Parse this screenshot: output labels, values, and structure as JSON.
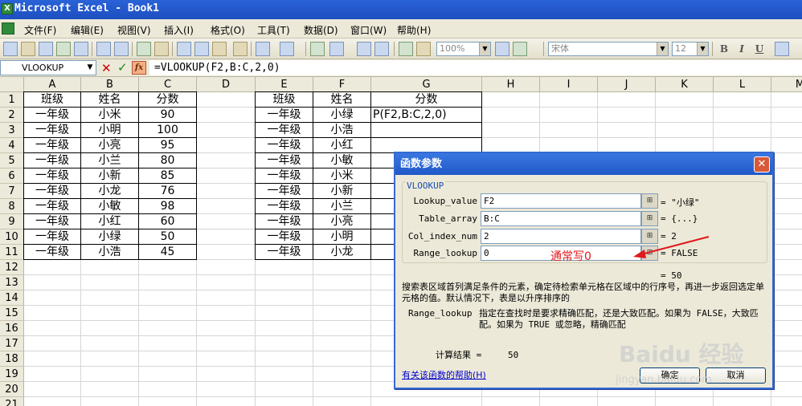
{
  "window": {
    "title": "Microsoft Excel - Book1"
  },
  "menu": [
    "文件(F)",
    "编辑(E)",
    "视图(V)",
    "插入(I)",
    "格式(O)",
    "工具(T)",
    "数据(D)",
    "窗口(W)",
    "帮助(H)"
  ],
  "toolbar": {
    "zoom": "100%",
    "font_name": "宋体",
    "font_size": "12",
    "bold": "B",
    "italic": "I",
    "underline": "U"
  },
  "formula_bar": {
    "name_box": "VLOOKUP",
    "cancel": "✕",
    "enter": "✓",
    "fx": "fx",
    "formula": "=VLOOKUP(F2,B:C,2,0)"
  },
  "columns": [
    "A",
    "B",
    "C",
    "D",
    "E",
    "F",
    "G",
    "H",
    "I",
    "J",
    "K",
    "L",
    "M"
  ],
  "rows": [
    "1",
    "2",
    "3",
    "4",
    "5",
    "6",
    "7",
    "8",
    "9",
    "10",
    "11",
    "12",
    "13",
    "14",
    "15",
    "16",
    "17",
    "18",
    "19",
    "20",
    "21"
  ],
  "table1": {
    "headers": [
      "班级",
      "姓名",
      "分数"
    ],
    "rows": [
      [
        "一年级",
        "小米",
        "90"
      ],
      [
        "一年级",
        "小明",
        "100"
      ],
      [
        "一年级",
        "小亮",
        "95"
      ],
      [
        "一年级",
        "小兰",
        "80"
      ],
      [
        "一年级",
        "小新",
        "85"
      ],
      [
        "一年级",
        "小龙",
        "76"
      ],
      [
        "一年级",
        "小敏",
        "98"
      ],
      [
        "一年级",
        "小红",
        "60"
      ],
      [
        "一年级",
        "小绿",
        "50"
      ],
      [
        "一年级",
        "小浩",
        "45"
      ]
    ]
  },
  "table2": {
    "headers": [
      "班级",
      "姓名",
      "分数"
    ],
    "rows": [
      [
        "一年级",
        "小绿"
      ],
      [
        "一年级",
        "小浩"
      ],
      [
        "一年级",
        "小红"
      ],
      [
        "一年级",
        "小敏"
      ],
      [
        "一年级",
        "小米"
      ],
      [
        "一年级",
        "小新"
      ],
      [
        "一年级",
        "小兰"
      ],
      [
        "一年级",
        "小亮"
      ],
      [
        "一年级",
        "小明"
      ],
      [
        "一年级",
        "小龙"
      ]
    ],
    "editing_cell_text": "P(F2,B:C,2,0)"
  },
  "dialog": {
    "title": "函数参数",
    "close": "✕",
    "function_name": "VLOOKUP",
    "args": [
      {
        "label": "Lookup_value",
        "value": "F2",
        "result": "= \"小绿\""
      },
      {
        "label": "Table_array",
        "value": "B:C",
        "result": "= {...}"
      },
      {
        "label": "Col_index_num",
        "value": "2",
        "result": "= 2"
      },
      {
        "label": "Range_lookup",
        "value": "0",
        "result": "= FALSE"
      }
    ],
    "summary_result": "= 50",
    "description": "搜索表区域首列满足条件的元素，确定待检索单元格在区域中的行序号，再进一步返回选定单元格的值。默认情况下，表是以升序排序的",
    "param_name": "Range_lookup",
    "param_desc": "指定在查找时是要求精确匹配，还是大致匹配。如果为 FALSE，大致匹配。如果为 TRUE 或忽略，精确匹配",
    "calc_label": "计算结果 =",
    "calc_value": "50",
    "help_link": "有关该函数的帮助(H)",
    "ok": "确定",
    "cancel": "取消"
  },
  "annotation": "通常写0",
  "watermark": {
    "main": "Baidu 经验",
    "sub": "jingyan.baidu.com"
  },
  "colors": {
    "title_blue": "#2058c8",
    "annotation_red": "#e0191c",
    "grid_line": "#d6d6d6"
  }
}
